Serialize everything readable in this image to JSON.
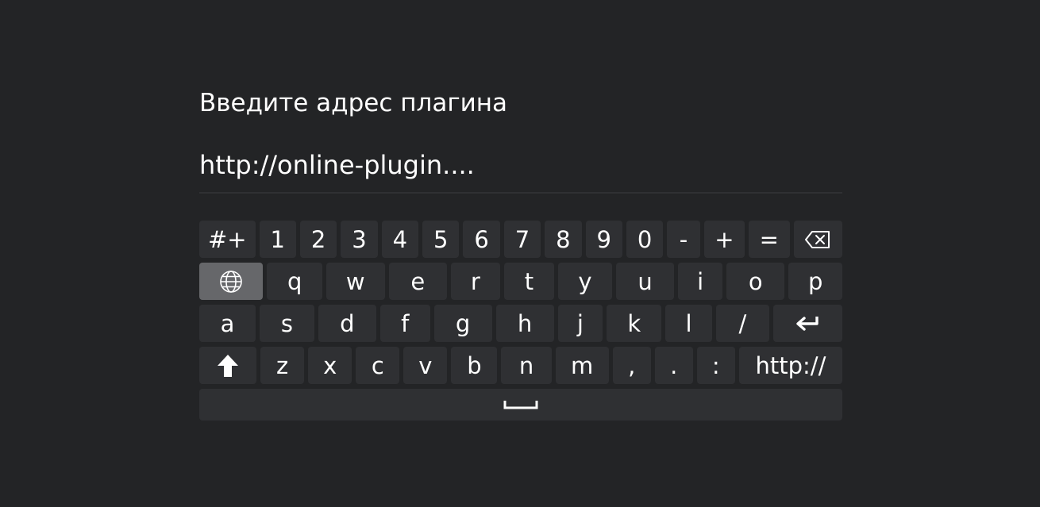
{
  "dialog": {
    "title": "Введите адрес плагина",
    "input_value": "http://online-plugin...."
  },
  "keyboard": {
    "row1": [
      "#+",
      "1",
      "2",
      "3",
      "4",
      "5",
      "6",
      "7",
      "8",
      "9",
      "0",
      "-",
      "+",
      "="
    ],
    "row2": [
      "q",
      "w",
      "e",
      "r",
      "t",
      "y",
      "u",
      "i",
      "o",
      "p"
    ],
    "row3": [
      "a",
      "s",
      "d",
      "f",
      "g",
      "h",
      "j",
      "k",
      "l",
      "/"
    ],
    "row4": [
      "z",
      "x",
      "c",
      "v",
      "b",
      "n",
      "m",
      ",",
      ".",
      ":",
      "http://"
    ],
    "icons": {
      "backspace": "backspace-icon",
      "language": "globe-icon",
      "enter": "enter-icon",
      "shift": "shift-icon",
      "space": "space-icon"
    },
    "active_key": "language"
  },
  "colors": {
    "background": "#232426",
    "key": "#2f3033",
    "key_active": "#66676a",
    "text": "#ffffff"
  }
}
